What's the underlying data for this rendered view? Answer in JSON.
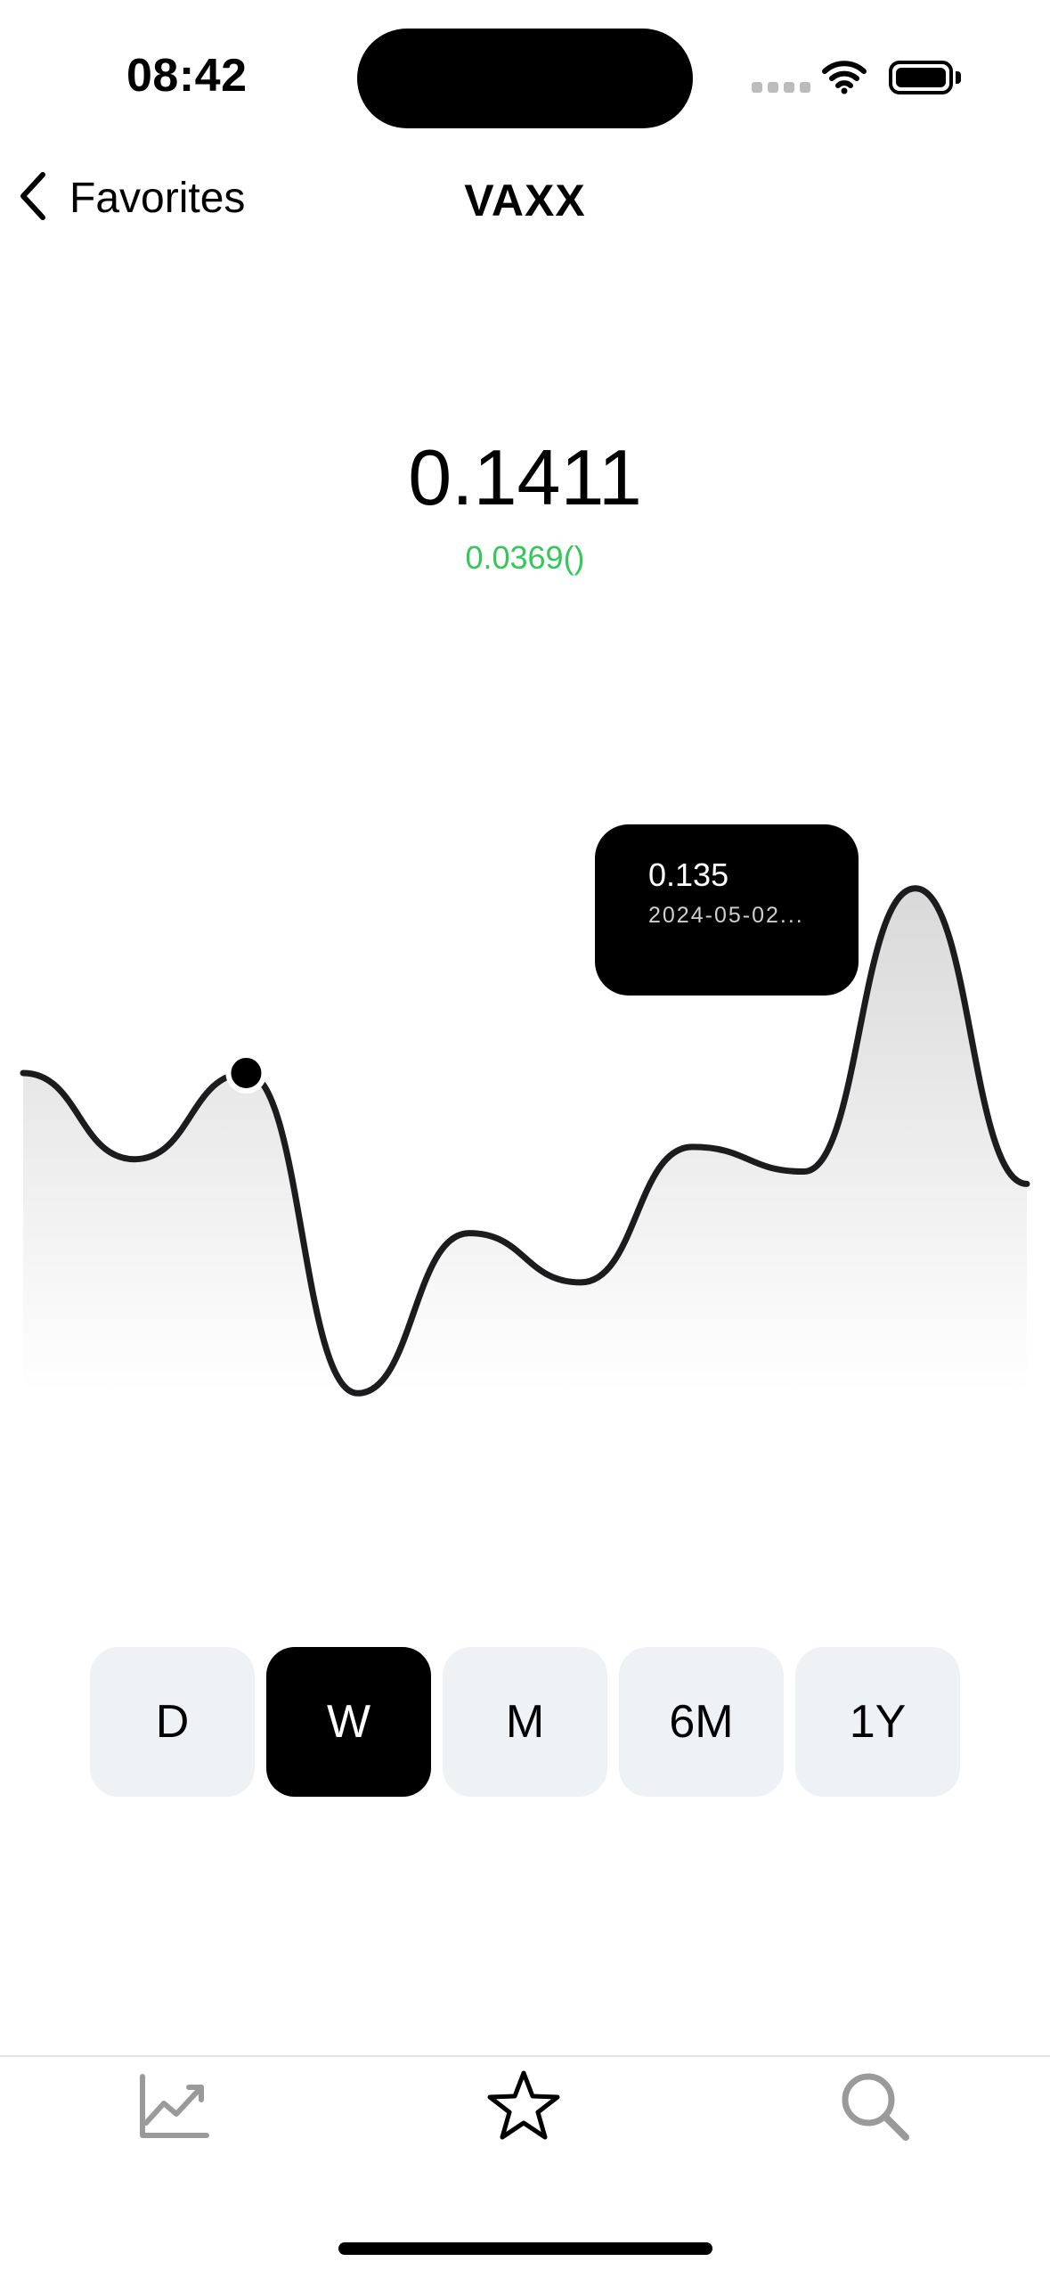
{
  "status_bar": {
    "time": "08:42"
  },
  "nav": {
    "back_label": "Favorites",
    "title": "VAXX"
  },
  "quote": {
    "price": "0.1411",
    "change": "0.0369()",
    "change_color": "#35c759"
  },
  "tooltip": {
    "value": "0.135",
    "date": "2024-05-02..."
  },
  "ranges": {
    "items": [
      {
        "label": "D"
      },
      {
        "label": "W"
      },
      {
        "label": "M"
      },
      {
        "label": "6M"
      },
      {
        "label": "1Y"
      }
    ],
    "selected": "W"
  },
  "tab_bar": {
    "tabs": [
      {
        "name": "chart",
        "icon": "chart-icon",
        "active": false
      },
      {
        "name": "favorites",
        "icon": "star-icon",
        "active": true
      },
      {
        "name": "search",
        "icon": "search-icon",
        "active": false
      }
    ]
  },
  "chart_data": {
    "type": "area",
    "title": "",
    "xlabel": "",
    "ylabel": "",
    "x": [
      0,
      1,
      2,
      3,
      4,
      5,
      6,
      7,
      8,
      9
    ],
    "values": [
      0.128,
      0.121,
      0.128,
      0.102,
      0.115,
      0.111,
      0.122,
      0.12,
      0.143,
      0.119
    ],
    "ylim": [
      0.095,
      0.15
    ],
    "grid": false,
    "selected_index": 2,
    "line_color": "#1c1c1e"
  }
}
